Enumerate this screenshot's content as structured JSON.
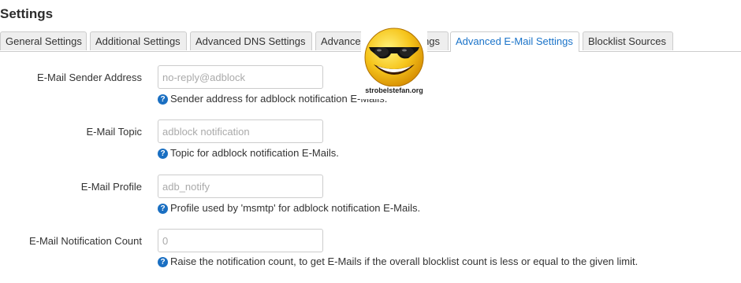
{
  "page": {
    "title": "Settings"
  },
  "tabs": [
    {
      "label": "General Settings",
      "active": false
    },
    {
      "label": "Additional Settings",
      "active": false
    },
    {
      "label": "Advanced DNS Settings",
      "active": false
    },
    {
      "label": "Advanced Report Settings",
      "active": false
    },
    {
      "label": "Advanced E-Mail Settings",
      "active": true
    },
    {
      "label": "Blocklist Sources",
      "active": false
    }
  ],
  "fields": {
    "sender": {
      "label": "E-Mail Sender Address",
      "placeholder": "no-reply@adblock",
      "value": "",
      "help": "Sender address for adblock notification E-Mails."
    },
    "topic": {
      "label": "E-Mail Topic",
      "placeholder": "adblock notification",
      "value": "",
      "help": "Topic for adblock notification E-Mails."
    },
    "profile": {
      "label": "E-Mail Profile",
      "placeholder": "adb_notify",
      "value": "",
      "help": "Profile used by 'msmtp' for adblock notification E-Mails."
    },
    "count": {
      "label": "E-Mail Notification Count",
      "placeholder": "0",
      "value": "",
      "help": "Raise the notification count, to get E-Mails if the overall blocklist count is less or equal to the given limit."
    }
  },
  "watermark": {
    "text": "strobelstefan.org",
    "icon": "sunglasses-smiley-icon"
  },
  "colors": {
    "accent": "#1a73c9",
    "help_icon": "#1a6fc2",
    "tab_inactive_bg": "#eeeeee",
    "border": "#cccccc"
  }
}
